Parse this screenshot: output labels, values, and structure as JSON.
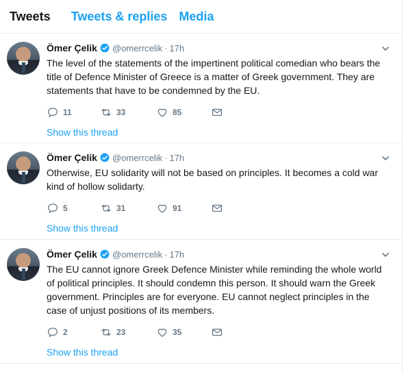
{
  "tabs": [
    {
      "label": "Tweets",
      "active": true
    },
    {
      "label": "Tweets & replies",
      "active": false
    },
    {
      "label": "Media",
      "active": false
    }
  ],
  "colors": {
    "accent": "#1da1f2",
    "text": "#14171a",
    "muted": "#657786",
    "border": "#e6ecf0"
  },
  "icons": {
    "verified": "verified-badge-icon",
    "caret": "chevron-down-icon",
    "reply": "reply-icon",
    "retweet": "retweet-icon",
    "like": "heart-icon",
    "message": "envelope-icon"
  },
  "tweets": [
    {
      "name": "Ömer Çelik",
      "handle": "@omerrcelik",
      "dot": "·",
      "time": "17h",
      "text": "The level of the statements of the impertinent political comedian who bears the title of Defence Minister of Greece is a matter of Greek government. They are statements that have to be condemned by the EU.",
      "replies": "11",
      "retweets": "33",
      "likes": "85",
      "thread_label": "Show this thread"
    },
    {
      "name": "Ömer Çelik",
      "handle": "@omerrcelik",
      "dot": "·",
      "time": "17h",
      "text": "Otherwise, EU solidarity will not be based on principles. It becomes a cold war kind of hollow solidarty.",
      "replies": "5",
      "retweets": "31",
      "likes": "91",
      "thread_label": "Show this thread"
    },
    {
      "name": "Ömer Çelik",
      "handle": "@omerrcelik",
      "dot": "·",
      "time": "17h",
      "text": "The EU cannot ignore Greek Defence Minister while reminding the whole world of political principles. It should condemn this person. It should warn the Greek government. Principles are for everyone. EU cannot neglect principles in the case of unjust positions of its members.",
      "replies": "2",
      "retweets": "23",
      "likes": "35",
      "thread_label": "Show this thread"
    }
  ]
}
